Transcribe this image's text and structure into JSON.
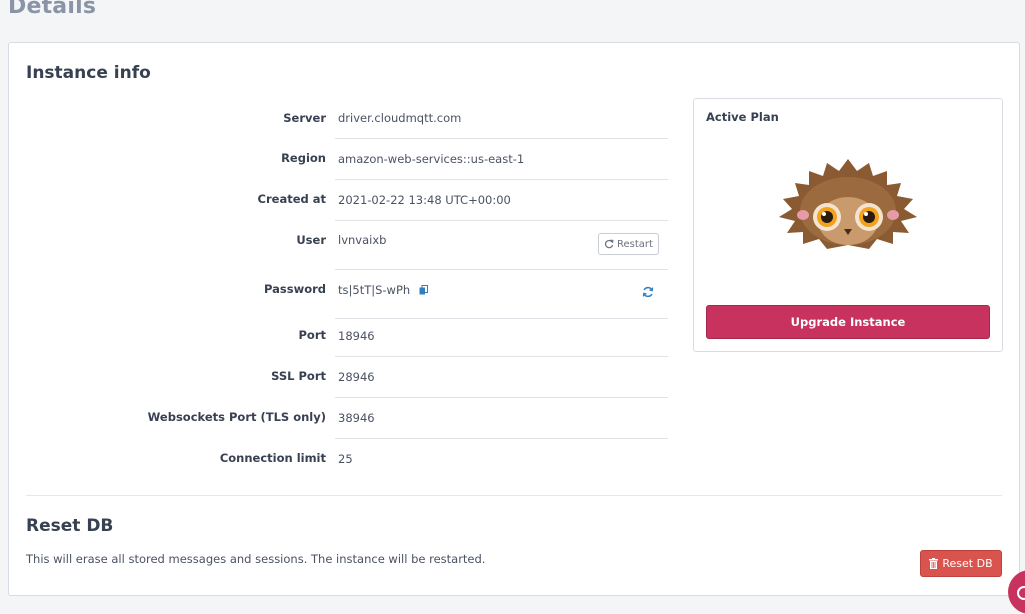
{
  "page": {
    "title": "Details"
  },
  "instance_info": {
    "title": "Instance info",
    "rows": [
      {
        "label": "Server",
        "value": "driver.cloudmqtt.com"
      },
      {
        "label": "Region",
        "value": "amazon-web-services::us-east-1"
      },
      {
        "label": "Created at",
        "value": "2021-02-22 13:48 UTC+00:00"
      },
      {
        "label": "User",
        "value": "lvnvaixb"
      },
      {
        "label": "Password",
        "value": "ts|5tT|S-wPh"
      },
      {
        "label": "Port",
        "value": "18946"
      },
      {
        "label": "SSL Port",
        "value": "28946"
      },
      {
        "label": "Websockets Port (TLS only)",
        "value": "38946"
      },
      {
        "label": "Connection limit",
        "value": "25"
      }
    ],
    "restart_label": "Restart"
  },
  "plan": {
    "title": "Active Plan",
    "upgrade_label": "Upgrade Instance"
  },
  "reset": {
    "title": "Reset DB",
    "description": "This will erase all stored messages and sessions. The instance will be restarted.",
    "button_label": "Reset DB"
  },
  "icons": {
    "restart": "refresh-icon",
    "password_copy": "copy-icon",
    "password_regenerate": "refresh-icon",
    "reset": "trash-icon",
    "chat": "chat-icon"
  },
  "colors": {
    "accent": "#c8325e",
    "danger": "#d9534f",
    "link_icon": "#2d7fc1"
  }
}
